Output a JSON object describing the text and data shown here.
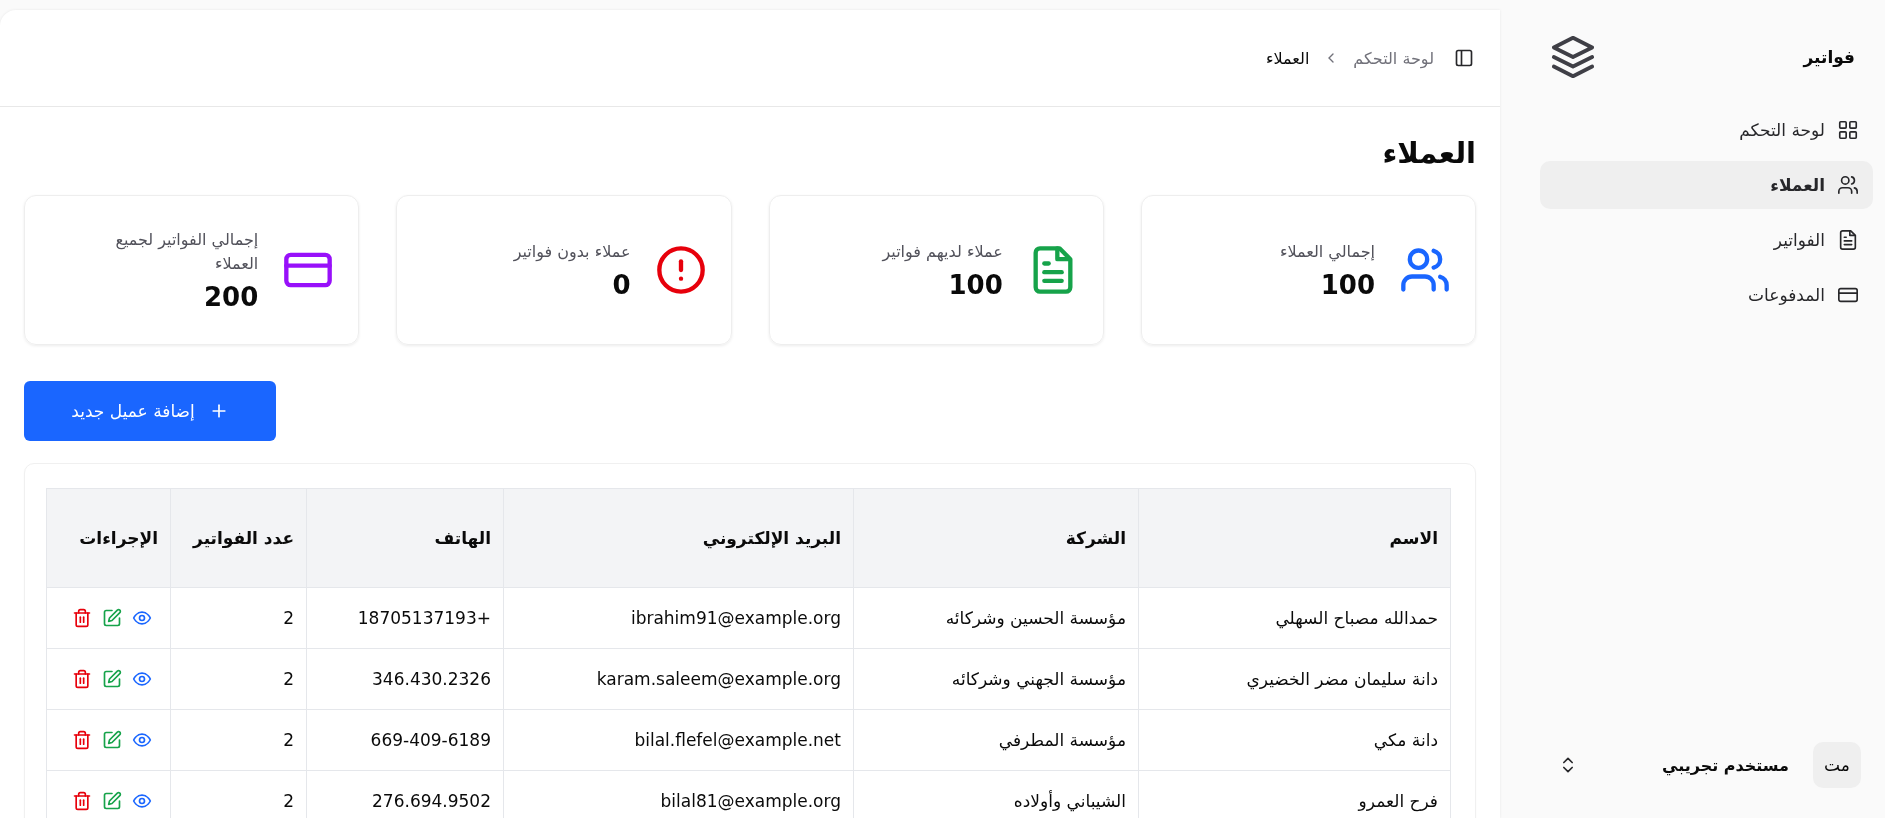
{
  "sidebar": {
    "brand": "فواتير",
    "items": [
      {
        "label": "لوحة التحكم",
        "selected": false
      },
      {
        "label": "العملاء",
        "selected": true
      },
      {
        "label": "الفواتير",
        "selected": false
      },
      {
        "label": "المدفوعات",
        "selected": false
      }
    ],
    "user": {
      "initials": "مت",
      "name": "مستخدم تجريبي"
    }
  },
  "breadcrumb": [
    {
      "label": "لوحة التحكم",
      "current": false
    },
    {
      "label": "العملاء",
      "current": true
    }
  ],
  "page_title": "العملاء",
  "stats": [
    {
      "label": "إجمالي العملاء",
      "value": "100",
      "color": "#1a66ff"
    },
    {
      "label": "عملاء لديهم فواتير",
      "value": "100",
      "color": "#16a34a"
    },
    {
      "label": "عملاء بدون فواتير",
      "value": "0",
      "color": "#e7000b"
    },
    {
      "label": "إجمالي الفواتير لجميع العملاء",
      "value": "200",
      "color": "#9810fa"
    }
  ],
  "add_button": {
    "label": "إضافة عميل جديد"
  },
  "table": {
    "columns": [
      "الاسم",
      "الشركة",
      "البريد الإلكتروني",
      "الهاتف",
      "عدد الفواتير",
      "الإجراءات"
    ],
    "rows": [
      {
        "cells": [
          "حمدالله مصباح السهلي",
          "مؤسسة الحسين وشركائه",
          "ibrahim91@example.org",
          "+18705137193",
          "2"
        ]
      },
      {
        "cells": [
          "دانة سليمان مضر الخضيري",
          "مؤسسة الجهني وشركائه",
          "karam.saleem@example.org",
          "346.430.2326",
          "2"
        ]
      },
      {
        "cells": [
          "دانة مكي",
          "مؤسسة المطرفي",
          "bilal.flefel@example.net",
          "669-409-6189",
          "2"
        ]
      },
      {
        "cells": [
          "فرح العمرو",
          "الشيباني وأولاده",
          "bilal81@example.org",
          "276.694.9502",
          "2"
        ]
      }
    ]
  }
}
